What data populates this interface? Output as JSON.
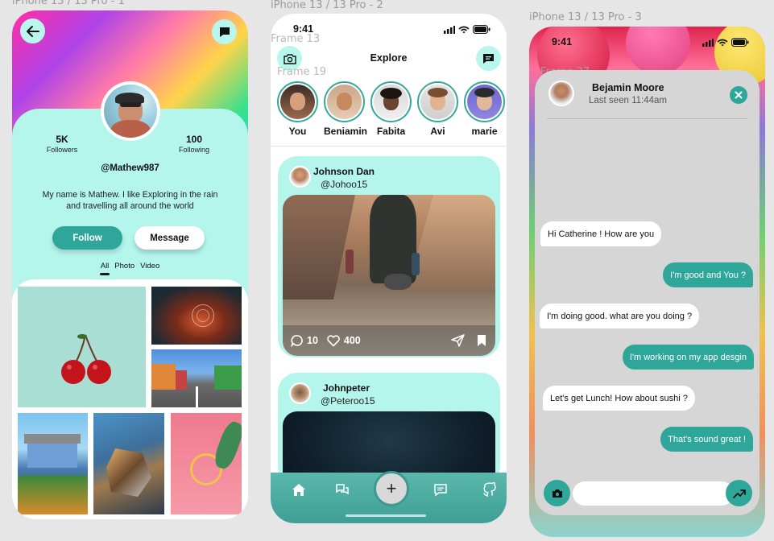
{
  "frames": {
    "frame1": "iPhone 13 / 13 Pro - 1",
    "frame2": "iPhone 13 / 13 Pro - 2",
    "frame3": "iPhone 13 / 13 Pro - 3",
    "frame13": "Frame 13",
    "frame19": "Frame 19",
    "frame27": "Frame 27"
  },
  "profile": {
    "followers_count": "5K",
    "followers_label": "Followers",
    "following_count": "100",
    "following_label": "Following",
    "username": "@Mathew987",
    "bio": "My name is Mathew. I like Exploring in the rain and travelling all around the world",
    "follow_label": "Follow",
    "message_label": "Message",
    "tabs": [
      "All",
      "Photo",
      "Video"
    ],
    "active_tab": "All"
  },
  "explore": {
    "time": "9:41",
    "title": "Explore",
    "stories": [
      "You",
      "Beniamin",
      "Fabita",
      "Avi",
      "marie"
    ],
    "posts": [
      {
        "author": "Johnson Dan",
        "handle": "@Johoo15",
        "comments": "10",
        "likes": "400"
      },
      {
        "author": "Johnpeter",
        "handle": "@Peteroo15"
      }
    ],
    "nav": {
      "add_label": "+"
    }
  },
  "chat": {
    "time": "9:41",
    "contact_name": "Bejamin Moore",
    "last_seen": "Last seen 11:44am",
    "messages": [
      {
        "from": "in",
        "text": "Hi Catherine ! How are you"
      },
      {
        "from": "out",
        "text": "I'm good and You ?"
      },
      {
        "from": "in",
        "text": "I'm doing good. what are you doing ?"
      },
      {
        "from": "out",
        "text": "I'm working on my app desgin"
      },
      {
        "from": "in",
        "text": "Let's get Lunch! How about sushi ?"
      },
      {
        "from": "out",
        "text": "That's sound great !"
      }
    ],
    "input_placeholder": ""
  },
  "colors": {
    "accent": "#2fa69a",
    "card": "#b4f5ec",
    "chat_panel": "#d6d6d6"
  }
}
